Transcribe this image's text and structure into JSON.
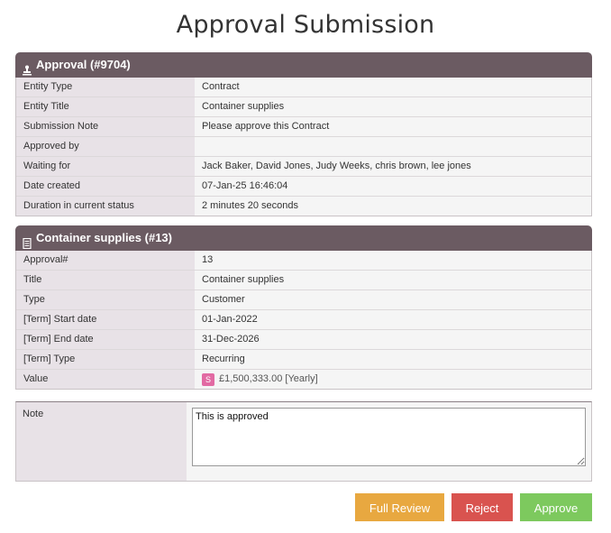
{
  "page": {
    "title": "Approval Submission"
  },
  "approval_panel": {
    "title": "Approval (#9704)",
    "icon": "stamp-icon",
    "rows": [
      {
        "label": "Entity Type",
        "value": "Contract"
      },
      {
        "label": "Entity Title",
        "value": "Container supplies"
      },
      {
        "label": "Submission Note",
        "value": "Please approve this Contract"
      },
      {
        "label": "Approved by",
        "value": ""
      },
      {
        "label": "Waiting for",
        "value": "Jack Baker, David Jones, Judy Weeks, chris brown, lee jones"
      },
      {
        "label": "Date created",
        "value": "07-Jan-25 16:46:04"
      },
      {
        "label": "Duration in current status",
        "value": "2 minutes 20 seconds"
      }
    ]
  },
  "contract_panel": {
    "title": "Container supplies (#13)",
    "icon": "document-icon",
    "rows": [
      {
        "label": "Approval#",
        "value": "13"
      },
      {
        "label": "Title",
        "value": "Container supplies"
      },
      {
        "label": "Type",
        "value": "Customer"
      },
      {
        "label": "[Term] Start date",
        "value": "01-Jan-2022"
      },
      {
        "label": "[Term] End date",
        "value": "31-Dec-2026"
      },
      {
        "label": "[Term] Type",
        "value": "Recurring"
      }
    ],
    "value_row": {
      "label": "Value",
      "badge": "S",
      "amount": "£1,500,333.00 [Yearly]"
    }
  },
  "note": {
    "label": "Note",
    "value": "This is approved"
  },
  "actions": {
    "full_review": "Full Review",
    "reject": "Reject",
    "approve": "Approve"
  },
  "colors": {
    "panel_header": "#6b5b62",
    "label_bg": "#e8e2e7",
    "full_review": "#e8a840",
    "reject": "#d9534f",
    "approve": "#7dc95e",
    "badge": "#e26aa3"
  }
}
